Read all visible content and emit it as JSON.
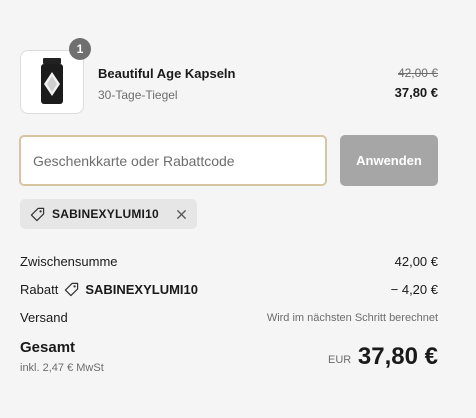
{
  "product": {
    "quantity": "1",
    "name": "Beautiful Age Kapseln",
    "variant": "30-Tage-Tiegel",
    "original_price": "42,00 €",
    "price": "37,80 €",
    "image_icon": "product-jar-icon"
  },
  "discount": {
    "placeholder": "Geschenkkarte oder Rabattcode",
    "value": "",
    "apply_label": "Anwenden",
    "applied_code": "SABINEXYLUMI10"
  },
  "summary": {
    "subtotal_label": "Zwischensumme",
    "subtotal_value": "42,00 €",
    "discount_label": "Rabatt",
    "discount_code": "SABINEXYLUMI10",
    "discount_value": "− 4,20 €",
    "shipping_label": "Versand",
    "shipping_value": "Wird im nächsten Schritt berechnet"
  },
  "total": {
    "label": "Gesamt",
    "tax_note": "inkl. 2,47 € MwSt",
    "currency": "EUR",
    "amount": "37,80 €"
  },
  "colors": {
    "background": "#f5f5f5",
    "input_border": "#d5c6a1",
    "button_disabled": "#a6a6a6",
    "badge": "#6f6f6f",
    "tag_background": "#e6e6e6",
    "muted_text": "#6d6d6d"
  }
}
